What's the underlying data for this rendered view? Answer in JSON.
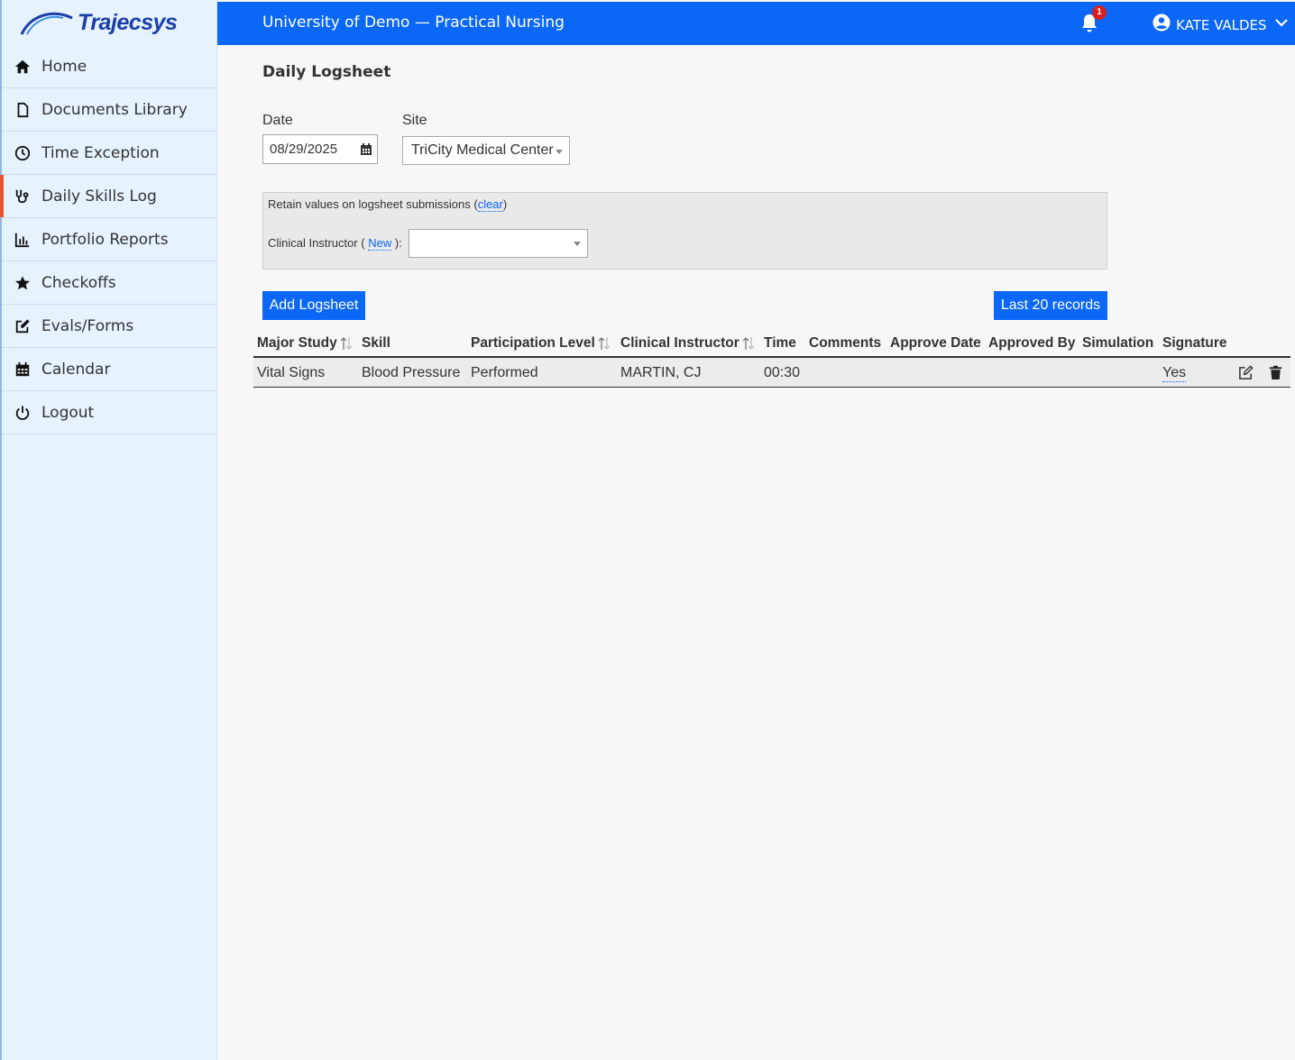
{
  "app": {
    "brand": "Trajecsys",
    "header_title": "University of Demo — Practical Nursing"
  },
  "notifications": {
    "count": "1"
  },
  "user": {
    "name": "KATE VALDES"
  },
  "sidebar": {
    "items": [
      {
        "label": "Home",
        "icon": "home-icon"
      },
      {
        "label": "Documents Library",
        "icon": "document-icon"
      },
      {
        "label": "Time Exception",
        "icon": "clock-icon"
      },
      {
        "label": "Daily Skills Log",
        "icon": "stethoscope-icon",
        "active": true
      },
      {
        "label": "Portfolio Reports",
        "icon": "bar-chart-icon"
      },
      {
        "label": "Checkoffs",
        "icon": "star-icon"
      },
      {
        "label": "Evals/Forms",
        "icon": "edit-icon"
      },
      {
        "label": "Calendar",
        "icon": "calendar-icon"
      },
      {
        "label": "Logout",
        "icon": "power-icon"
      }
    ]
  },
  "page": {
    "title": "Daily Logsheet",
    "date_label": "Date",
    "date_value": "08/29/2025",
    "site_label": "Site",
    "site_value": "TriCity Medical Center",
    "retain_text": "Retain values on logsheet submissions (",
    "retain_clear": "clear",
    "retain_close": ")",
    "ci_label_pre": "Clinical Instructor (",
    "ci_new": "New",
    "ci_label_post": "):",
    "ci_value": "",
    "add_button": "Add Logsheet",
    "last_button": "Last 20 records"
  },
  "table": {
    "headers": [
      "Major Study",
      "Skill",
      "Participation Level",
      "Clinical Instructor",
      "Time",
      "Comments",
      "Approve Date",
      "Approved By",
      "Simulation",
      "Signature"
    ],
    "rows": [
      {
        "major_study": "Vital Signs",
        "skill": "Blood Pressure",
        "participation": "Performed",
        "instructor": "MARTIN, CJ",
        "time": "00:30",
        "comments": "",
        "approve_date": "",
        "approved_by": "",
        "simulation": "",
        "signature": "Yes"
      }
    ]
  },
  "colors": {
    "primary": "#0b67f5",
    "sidebar_bg": "#e6f2fe",
    "active_marker": "#e8532b",
    "badge": "#d62020"
  }
}
